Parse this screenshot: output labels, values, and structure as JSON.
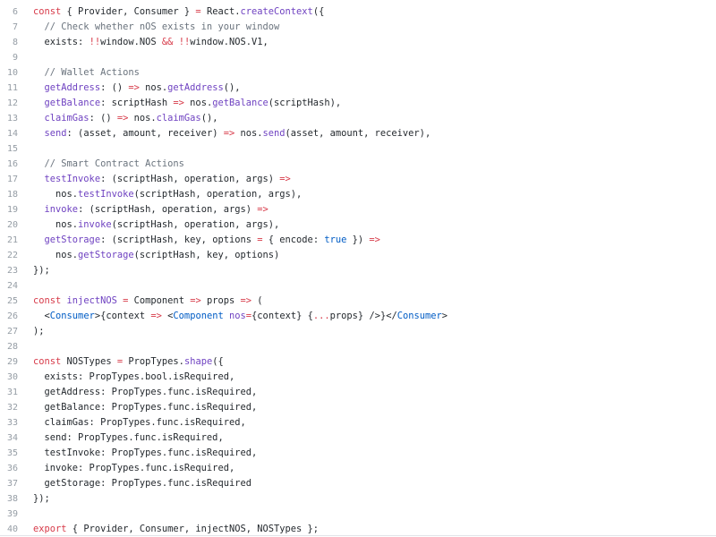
{
  "colors": {
    "keyword": "#d73a49",
    "function": "#6f42c1",
    "comment": "#6a737d",
    "tag": "#22863a",
    "constant": "#005cc5",
    "text": "#24292e",
    "line_number": "#959da5"
  },
  "lines": [
    {
      "n": "6",
      "tokens": [
        [
          "kw",
          "const"
        ],
        [
          "plain",
          " { Provider, Consumer } "
        ],
        [
          "kw",
          "="
        ],
        [
          "plain",
          " React."
        ],
        [
          "fn",
          "createContext"
        ],
        [
          "plain",
          "({"
        ]
      ]
    },
    {
      "n": "7",
      "tokens": [
        [
          "plain",
          "  "
        ],
        [
          "cm",
          "// Check whether nOS exists in your window"
        ]
      ]
    },
    {
      "n": "8",
      "tokens": [
        [
          "plain",
          "  exists: "
        ],
        [
          "kw",
          "!!"
        ],
        [
          "plain",
          "window.NOS "
        ],
        [
          "kw",
          "&&"
        ],
        [
          "plain",
          " "
        ],
        [
          "kw",
          "!!"
        ],
        [
          "plain",
          "window.NOS.V1,"
        ]
      ]
    },
    {
      "n": "9",
      "tokens": []
    },
    {
      "n": "10",
      "tokens": [
        [
          "plain",
          "  "
        ],
        [
          "cm",
          "// Wallet Actions"
        ]
      ]
    },
    {
      "n": "11",
      "tokens": [
        [
          "plain",
          "  "
        ],
        [
          "fn",
          "getAddress"
        ],
        [
          "plain",
          ": () "
        ],
        [
          "kw",
          "=>"
        ],
        [
          "plain",
          " nos."
        ],
        [
          "fn",
          "getAddress"
        ],
        [
          "plain",
          "(),"
        ]
      ]
    },
    {
      "n": "12",
      "tokens": [
        [
          "plain",
          "  "
        ],
        [
          "fn",
          "getBalance"
        ],
        [
          "plain",
          ": scriptHash "
        ],
        [
          "kw",
          "=>"
        ],
        [
          "plain",
          " nos."
        ],
        [
          "fn",
          "getBalance"
        ],
        [
          "plain",
          "(scriptHash),"
        ]
      ]
    },
    {
      "n": "13",
      "tokens": [
        [
          "plain",
          "  "
        ],
        [
          "fn",
          "claimGas"
        ],
        [
          "plain",
          ": () "
        ],
        [
          "kw",
          "=>"
        ],
        [
          "plain",
          " nos."
        ],
        [
          "fn",
          "claimGas"
        ],
        [
          "plain",
          "(),"
        ]
      ]
    },
    {
      "n": "14",
      "tokens": [
        [
          "plain",
          "  "
        ],
        [
          "fn",
          "send"
        ],
        [
          "plain",
          ": (asset, amount, receiver) "
        ],
        [
          "kw",
          "=>"
        ],
        [
          "plain",
          " nos."
        ],
        [
          "fn",
          "send"
        ],
        [
          "plain",
          "(asset, amount, receiver),"
        ]
      ]
    },
    {
      "n": "15",
      "tokens": []
    },
    {
      "n": "16",
      "tokens": [
        [
          "plain",
          "  "
        ],
        [
          "cm",
          "// Smart Contract Actions"
        ]
      ]
    },
    {
      "n": "17",
      "tokens": [
        [
          "plain",
          "  "
        ],
        [
          "fn",
          "testInvoke"
        ],
        [
          "plain",
          ": (scriptHash, operation, args) "
        ],
        [
          "kw",
          "=>"
        ]
      ]
    },
    {
      "n": "18",
      "tokens": [
        [
          "plain",
          "    nos."
        ],
        [
          "fn",
          "testInvoke"
        ],
        [
          "plain",
          "(scriptHash, operation, args),"
        ]
      ]
    },
    {
      "n": "19",
      "tokens": [
        [
          "plain",
          "  "
        ],
        [
          "fn",
          "invoke"
        ],
        [
          "plain",
          ": (scriptHash, operation, args) "
        ],
        [
          "kw",
          "=>"
        ]
      ]
    },
    {
      "n": "20",
      "tokens": [
        [
          "plain",
          "    nos."
        ],
        [
          "fn",
          "invoke"
        ],
        [
          "plain",
          "(scriptHash, operation, args),"
        ]
      ]
    },
    {
      "n": "21",
      "tokens": [
        [
          "plain",
          "  "
        ],
        [
          "fn",
          "getStorage"
        ],
        [
          "plain",
          ": (scriptHash, key, options "
        ],
        [
          "kw",
          "="
        ],
        [
          "plain",
          " { encode: "
        ],
        [
          "const",
          "true"
        ],
        [
          "plain",
          " }) "
        ],
        [
          "kw",
          "=>"
        ]
      ]
    },
    {
      "n": "22",
      "tokens": [
        [
          "plain",
          "    nos."
        ],
        [
          "fn",
          "getStorage"
        ],
        [
          "plain",
          "(scriptHash, key, options)"
        ]
      ]
    },
    {
      "n": "23",
      "tokens": [
        [
          "plain",
          "});"
        ]
      ]
    },
    {
      "n": "24",
      "tokens": []
    },
    {
      "n": "25",
      "tokens": [
        [
          "kw",
          "const"
        ],
        [
          "plain",
          " "
        ],
        [
          "fn",
          "injectNOS"
        ],
        [
          "plain",
          " "
        ],
        [
          "kw",
          "="
        ],
        [
          "plain",
          " Component "
        ],
        [
          "kw",
          "=>"
        ],
        [
          "plain",
          " props "
        ],
        [
          "kw",
          "=>"
        ],
        [
          "plain",
          " ("
        ]
      ]
    },
    {
      "n": "26",
      "tokens": [
        [
          "plain",
          "  <"
        ],
        [
          "const",
          "Consumer"
        ],
        [
          "plain",
          ">{context "
        ],
        [
          "kw",
          "=>"
        ],
        [
          "plain",
          " <"
        ],
        [
          "const",
          "Component"
        ],
        [
          "plain",
          " "
        ],
        [
          "fn",
          "nos"
        ],
        [
          "kw",
          "="
        ],
        [
          "plain",
          "{context} {"
        ],
        [
          "kw",
          "..."
        ],
        [
          "plain",
          "props} />}</"
        ],
        [
          "const",
          "Consumer"
        ],
        [
          "plain",
          ">"
        ]
      ]
    },
    {
      "n": "27",
      "tokens": [
        [
          "plain",
          ");"
        ]
      ]
    },
    {
      "n": "28",
      "tokens": []
    },
    {
      "n": "29",
      "tokens": [
        [
          "kw",
          "const"
        ],
        [
          "plain",
          " NOSTypes "
        ],
        [
          "kw",
          "="
        ],
        [
          "plain",
          " PropTypes."
        ],
        [
          "fn",
          "shape"
        ],
        [
          "plain",
          "({"
        ]
      ]
    },
    {
      "n": "30",
      "tokens": [
        [
          "plain",
          "  exists: PropTypes.bool.isRequired,"
        ]
      ]
    },
    {
      "n": "31",
      "tokens": [
        [
          "plain",
          "  getAddress: PropTypes.func.isRequired,"
        ]
      ]
    },
    {
      "n": "32",
      "tokens": [
        [
          "plain",
          "  getBalance: PropTypes.func.isRequired,"
        ]
      ]
    },
    {
      "n": "33",
      "tokens": [
        [
          "plain",
          "  claimGas: PropTypes.func.isRequired,"
        ]
      ]
    },
    {
      "n": "34",
      "tokens": [
        [
          "plain",
          "  send: PropTypes.func.isRequired,"
        ]
      ]
    },
    {
      "n": "35",
      "tokens": [
        [
          "plain",
          "  testInvoke: PropTypes.func.isRequired,"
        ]
      ]
    },
    {
      "n": "36",
      "tokens": [
        [
          "plain",
          "  invoke: PropTypes.func.isRequired,"
        ]
      ]
    },
    {
      "n": "37",
      "tokens": [
        [
          "plain",
          "  getStorage: PropTypes.func.isRequired"
        ]
      ]
    },
    {
      "n": "38",
      "tokens": [
        [
          "plain",
          "});"
        ]
      ]
    },
    {
      "n": "39",
      "tokens": []
    },
    {
      "n": "40",
      "tokens": [
        [
          "kw",
          "export"
        ],
        [
          "plain",
          " { Provider, Consumer, injectNOS, NOSTypes };"
        ]
      ]
    }
  ]
}
